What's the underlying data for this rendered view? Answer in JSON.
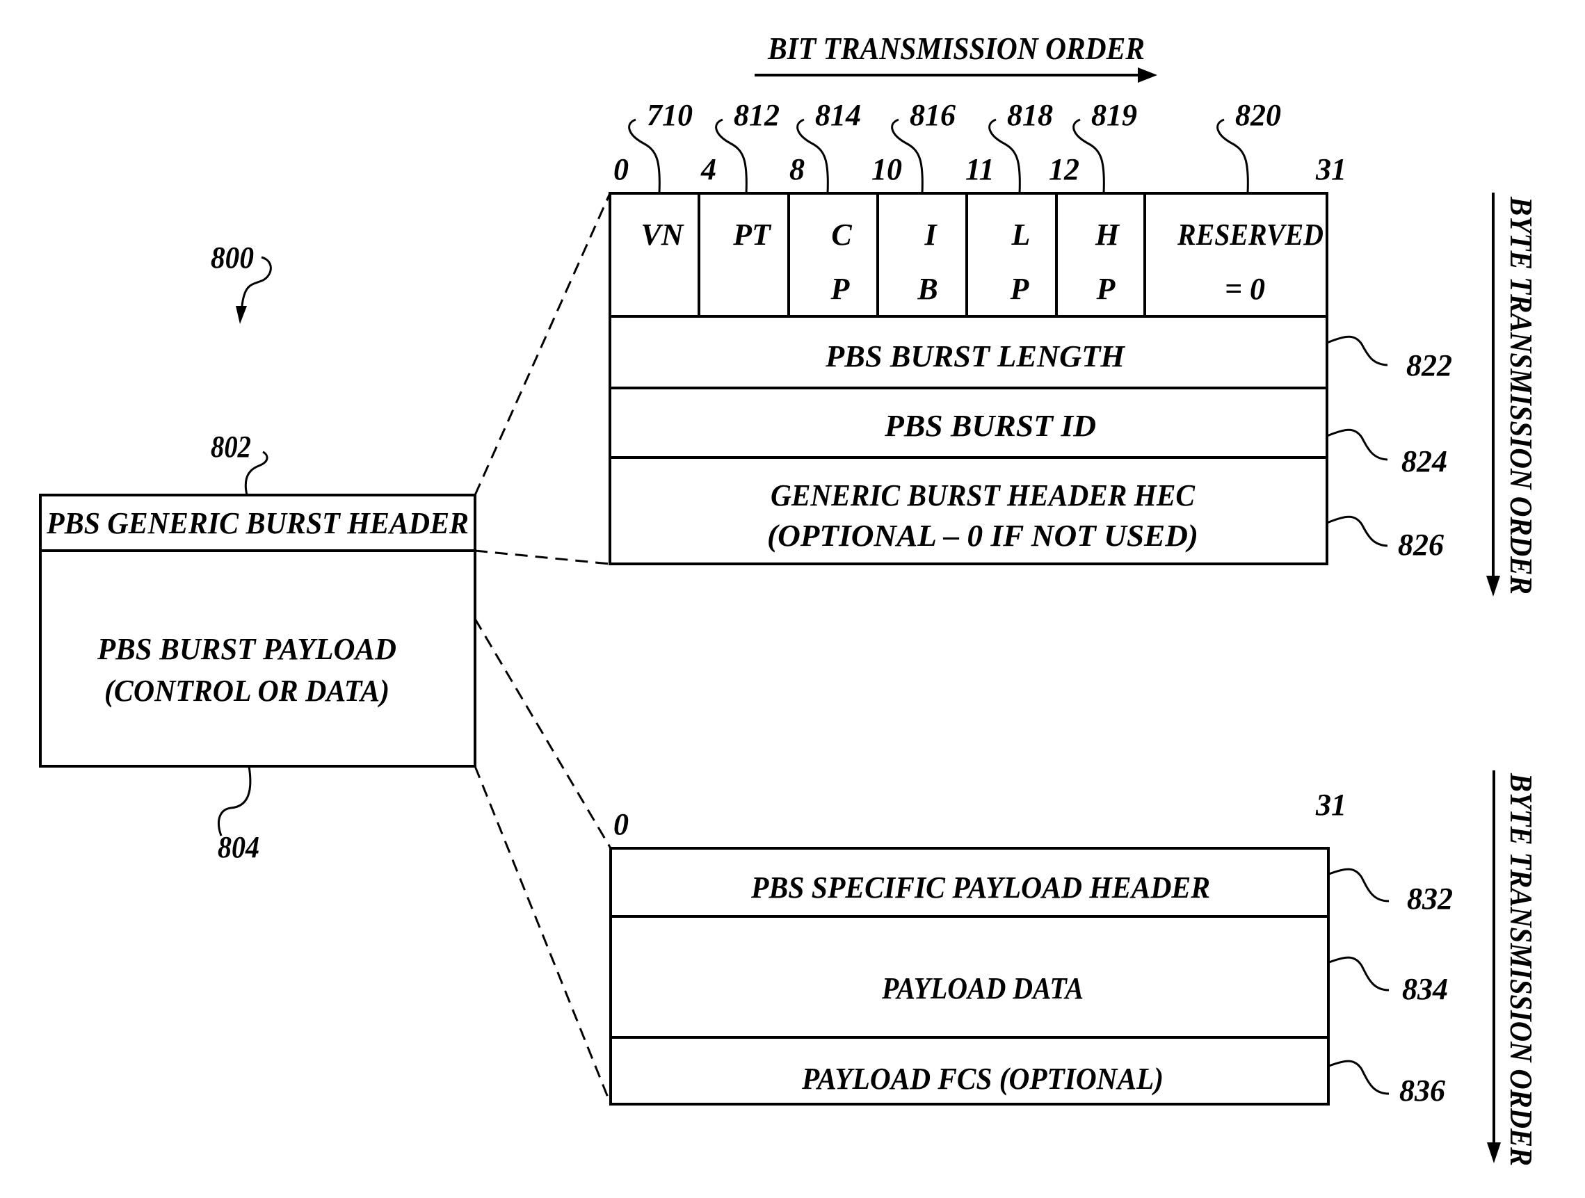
{
  "figure_ref": "800",
  "bit_order": {
    "label": "BIT TRANSMISSION ORDER"
  },
  "byte_order": {
    "label": "BYTE TRANSMISSION ORDER"
  },
  "burst": {
    "header_label": "PBS GENERIC BURST HEADER",
    "header_ref": "802",
    "payload_line1": "PBS BURST PAYLOAD",
    "payload_line2": "(CONTROL OR DATA)",
    "payload_ref": "804"
  },
  "generic_header": {
    "bit_positions": [
      "0",
      "4",
      "8",
      "10",
      "11",
      "12",
      "31"
    ],
    "fields": [
      {
        "line1": "VN",
        "line2": "",
        "ref": "710"
      },
      {
        "line1": "PT",
        "line2": "",
        "ref": "812"
      },
      {
        "line1": "C",
        "line2": "P",
        "ref": "814"
      },
      {
        "line1": "I",
        "line2": "B",
        "ref": "816"
      },
      {
        "line1": "L",
        "line2": "P",
        "ref": "818"
      },
      {
        "line1": "H",
        "line2": "P",
        "ref": "819"
      },
      {
        "line1": "RESERVED",
        "line2": "= 0",
        "ref": "820"
      }
    ],
    "rows": [
      {
        "line1": "PBS BURST LENGTH",
        "ref": "822"
      },
      {
        "line1": "PBS BURST ID",
        "ref": "824"
      },
      {
        "line1": "GENERIC BURST HEADER HEC",
        "line2": "(OPTIONAL – 0 IF NOT USED)",
        "ref": "826"
      }
    ]
  },
  "payload_format": {
    "bit_start": "0",
    "bit_end": "31",
    "rows": [
      {
        "line1": "PBS SPECIFIC PAYLOAD HEADER",
        "ref": "832"
      },
      {
        "line1": "PAYLOAD DATA",
        "ref": "834"
      },
      {
        "line1": "PAYLOAD FCS (OPTIONAL)",
        "ref": "836"
      }
    ]
  }
}
